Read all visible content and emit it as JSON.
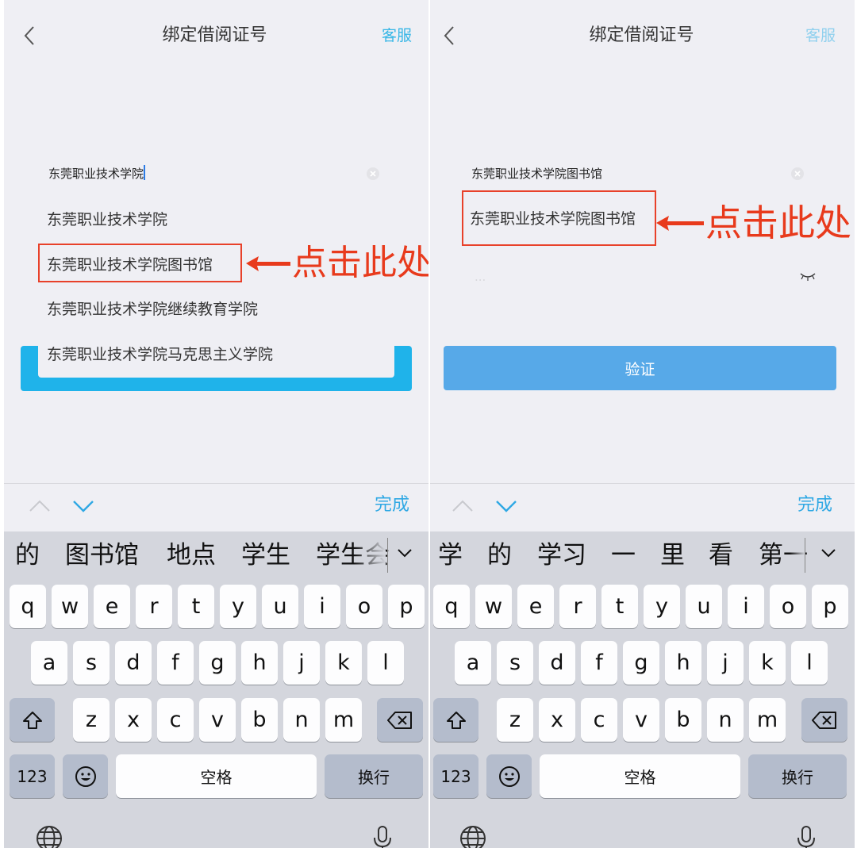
{
  "common": {
    "title": "绑定借阅证号",
    "service": "客服",
    "done": "完成",
    "annotation": "点击此处"
  },
  "left": {
    "input_value": "东莞职业技术学院",
    "suggestions": [
      "东莞职业技术学院",
      "东莞职业技术学院图书馆",
      "东莞职业技术学院继续教育学院",
      "东莞职业技术学院马克思主义学院"
    ],
    "candidates": [
      "的",
      "图书馆",
      "地点",
      "学生",
      "学生会"
    ]
  },
  "right": {
    "input_value": "东莞职业技术学院图书馆",
    "suggestion": "东莞职业技术学院图书馆",
    "password_placeholder": "...",
    "verify": "验证",
    "candidates": [
      "学",
      "的",
      "学习",
      "一",
      "里",
      "看",
      "第一"
    ]
  },
  "keyboard": {
    "row1": [
      "q",
      "w",
      "e",
      "r",
      "t",
      "y",
      "u",
      "i",
      "o",
      "p"
    ],
    "row2": [
      "a",
      "s",
      "d",
      "f",
      "g",
      "h",
      "j",
      "k",
      "l"
    ],
    "row3": [
      "z",
      "x",
      "c",
      "v",
      "b",
      "n",
      "m"
    ],
    "num": "123",
    "space": "空格",
    "enter": "换行"
  },
  "colors": {
    "accent": "#36b6e6",
    "annotation": "#e83a1c",
    "verify_button": "#57a9e8",
    "blue_frame": "#1fb3ea"
  },
  "icons": [
    "back-icon",
    "clear-icon",
    "eye-closed-icon",
    "chevron-up-icon",
    "chevron-down-icon",
    "shift-icon",
    "backspace-icon",
    "emoji-icon",
    "globe-icon",
    "microphone-icon"
  ]
}
